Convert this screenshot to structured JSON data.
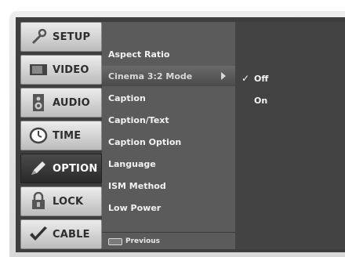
{
  "categories": [
    {
      "label": "SETUP",
      "icon": "wrench-icon",
      "active": false
    },
    {
      "label": "VIDEO",
      "icon": "tv-icon",
      "active": false
    },
    {
      "label": "AUDIO",
      "icon": "speaker-icon",
      "active": false
    },
    {
      "label": "TIME",
      "icon": "clock-icon",
      "active": false
    },
    {
      "label": "OPTION",
      "icon": "pencil-icon",
      "active": true
    },
    {
      "label": "LOCK",
      "icon": "padlock-icon",
      "active": false
    },
    {
      "label": "CABLE",
      "icon": "checkmark-icon",
      "active": false
    }
  ],
  "menu_items": [
    {
      "label": "Aspect Ratio",
      "selected": false
    },
    {
      "label": "Cinema 3:2 Mode",
      "selected": true
    },
    {
      "label": "Caption",
      "selected": false
    },
    {
      "label": "Caption/Text",
      "selected": false
    },
    {
      "label": "Caption Option",
      "selected": false
    },
    {
      "label": "Language",
      "selected": false
    },
    {
      "label": "ISM Method",
      "selected": false
    },
    {
      "label": "Low Power",
      "selected": false
    }
  ],
  "options": [
    {
      "label": "Off",
      "checked": true,
      "check_mark": "✓"
    },
    {
      "label": "On",
      "checked": false,
      "check_mark": ""
    }
  ],
  "footer": {
    "key_icon": "menu-key-icon",
    "label": "Previous"
  },
  "colors": {
    "active_category_bg": "#3a3a3a",
    "list_bg": "#5b5b5b",
    "option_bg": "#434343"
  }
}
